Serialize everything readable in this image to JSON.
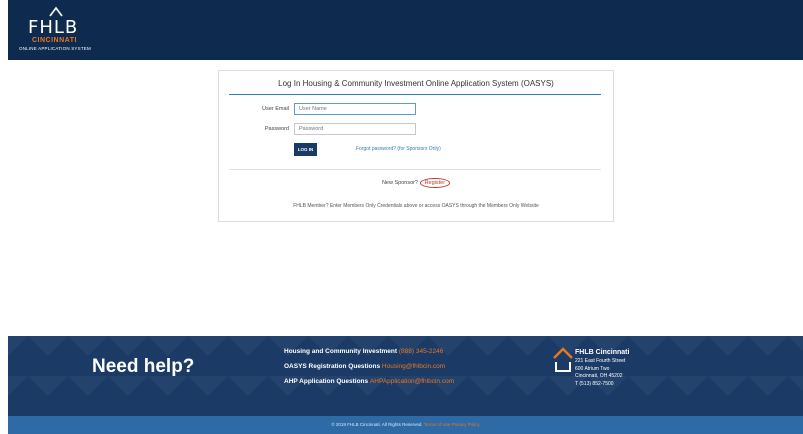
{
  "header": {
    "logo_main": "FHLB",
    "logo_sub": "CINCINNATI",
    "logo_app": "ONLINE APPLICATION SYSTEM",
    "bg_color": "#0e2a4f"
  },
  "login": {
    "title": "Log In Housing & Community Investment Online Application System (OASYS)",
    "email_label": "User Email",
    "email_placeholder": "User Name",
    "password_label": "Password",
    "password_placeholder": "Password",
    "login_button": "LOG IN",
    "forgot_link": "Forgot password? (for Sponsors Only)",
    "new_sponsor_text": "New Sponsor?",
    "register_link": "Register",
    "member_note": "FHLB Member? Enter Members Only Credentials above or access OASYS through the Members Only Website"
  },
  "footer": {
    "need_help": "Need help?",
    "contacts": [
      {
        "label": "Housing and Community Investment",
        "value": "(888) 345-2246"
      },
      {
        "label": "OASYS Registration Questions",
        "value": "Housing@fhlbcin.com"
      },
      {
        "label": "AHP Application Questions",
        "value": "AHPApplication@fhlbcin.com"
      }
    ],
    "address": {
      "name": "FHLB Cincinnati",
      "line1": "221 East Fourth Street",
      "line2": "600 Atrium Two",
      "line3": "Cincinnati, OH 45202",
      "phone": "T (513) 852-7500"
    },
    "copyright": "© 2019 FHLB Cincinnati. All Rights Reserved.",
    "terms_link": "Terms of Use",
    "privacy_link": "Privacy Policy",
    "accent_color": "#e87722"
  }
}
